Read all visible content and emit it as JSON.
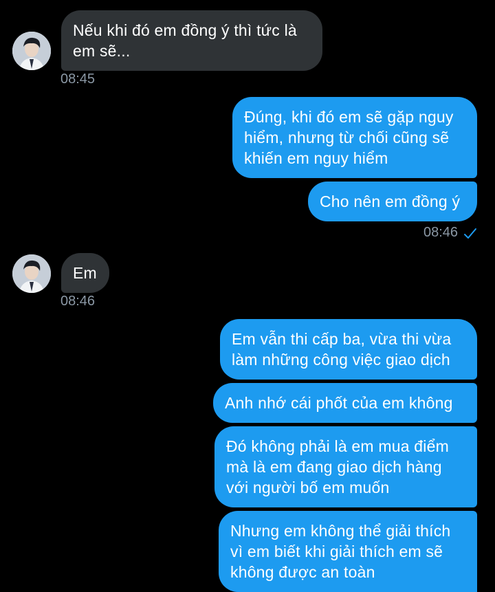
{
  "colors": {
    "background": "#000000",
    "incoming_bubble": "#2f3336",
    "outgoing_bubble": "#1d9bf0",
    "timestamp": "#8b98a5",
    "read_check": "#1d9bf0"
  },
  "messages": [
    {
      "id": "m1",
      "direction": "incoming",
      "text": "Nếu khi đó em đồng ý thì tức là em sẽ...",
      "time": "08:45"
    },
    {
      "id": "m2",
      "direction": "outgoing",
      "text": "Đúng, khi đó em sẽ gặp nguy hiểm, nhưng từ chối cũng sẽ khiến em nguy hiểm"
    },
    {
      "id": "m3",
      "direction": "outgoing",
      "text": "Cho nên em đồng ý",
      "time": "08:46",
      "status_icon": "read-check-icon"
    },
    {
      "id": "m4",
      "direction": "incoming",
      "text": "Em",
      "time": "08:46"
    },
    {
      "id": "m5",
      "direction": "outgoing",
      "text": "Em vẫn thi cấp ba, vừa thi vừa làm những công việc giao dịch"
    },
    {
      "id": "m6",
      "direction": "outgoing",
      "text": "Anh nhớ cái phốt của em không"
    },
    {
      "id": "m7",
      "direction": "outgoing",
      "text": "Đó không phải là em mua điểm mà là em đang giao dịch hàng với người bố em muốn"
    },
    {
      "id": "m8",
      "direction": "outgoing",
      "text": "Nhưng em không thể giải thích vì em biết khi giải thích em sẽ không được an toàn"
    }
  ]
}
